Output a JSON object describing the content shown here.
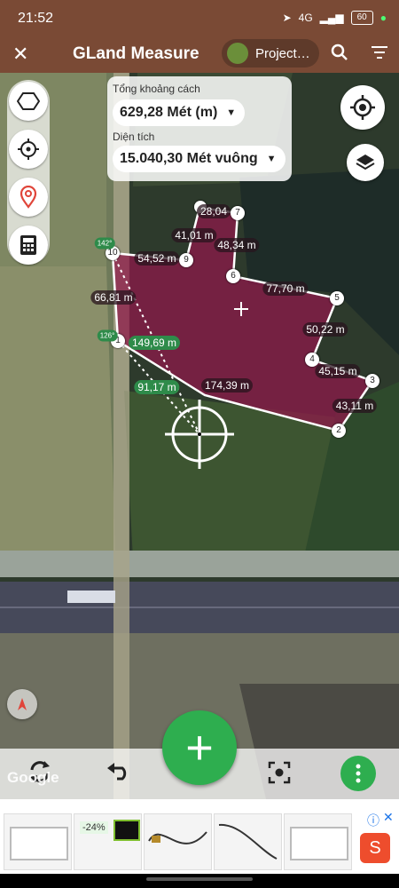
{
  "status": {
    "time": "21:52",
    "network": "4G",
    "battery": "60"
  },
  "app": {
    "title": "GLand Measure",
    "project": "Project…"
  },
  "measure": {
    "distance_label": "Tổng khoảng cách",
    "distance_value": "629,28 Mét (m)",
    "area_label": "Diện tích",
    "area_value": "15.040,30 Mét vuông"
  },
  "vertices": [
    "1",
    "2",
    "3",
    "4",
    "5",
    "6",
    "7",
    "9",
    "10"
  ],
  "segment_labels": [
    "28,04",
    "41,01 m",
    "48,34 m",
    "54,52 m",
    "77,70 m",
    "66,81 m",
    "50,22 m",
    "149,69 m",
    "45,15 m",
    "91,17 m",
    "174,39 m",
    "43,11 m"
  ],
  "marker_labels": [
    "142°",
    "126°"
  ],
  "ads": {
    "discount": "-24%"
  },
  "map_attribution": "Google",
  "icons": [
    "close-icon",
    "search-icon",
    "filter-icon",
    "polygon-icon",
    "crosshair-icon",
    "location-pin-icon",
    "calculator-icon",
    "my-location-icon",
    "layers-icon",
    "compass-icon",
    "refresh-icon",
    "undo-icon",
    "focus-icon",
    "more-icon",
    "plus-icon"
  ],
  "colors": {
    "appbar": "#7a4a35",
    "polygon": "#8e1a4a",
    "fab": "#2eae4f"
  }
}
